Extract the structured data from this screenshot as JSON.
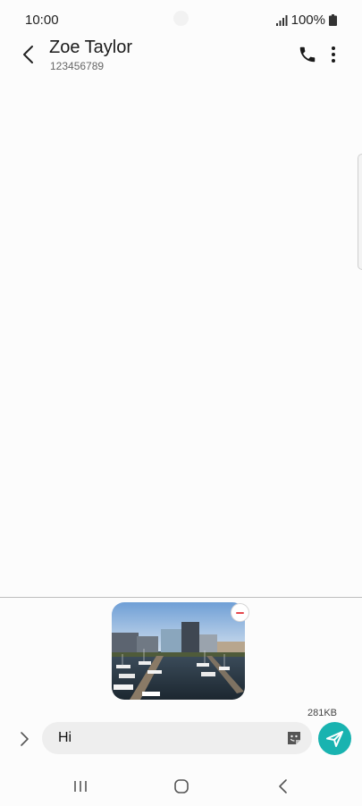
{
  "status_bar": {
    "time": "10:00",
    "battery": "100%",
    "icons": [
      "signal-icon",
      "battery-icon"
    ]
  },
  "header": {
    "contact_name": "Zoe Taylor",
    "contact_number": "123456789",
    "icons": [
      "back-arrow-icon",
      "phone-icon",
      "more-options-icon"
    ]
  },
  "compose": {
    "attachment": {
      "type": "image",
      "description_icon": "harbor-photo",
      "size": "281KB"
    },
    "message_text": "Hi",
    "icons": [
      "expand-chevron-icon",
      "sticker-icon",
      "send-icon",
      "remove-attachment-icon"
    ],
    "send_color": "#19b3b0"
  },
  "nav_bar": {
    "icons": [
      "recents-icon",
      "home-icon",
      "back-icon"
    ]
  }
}
